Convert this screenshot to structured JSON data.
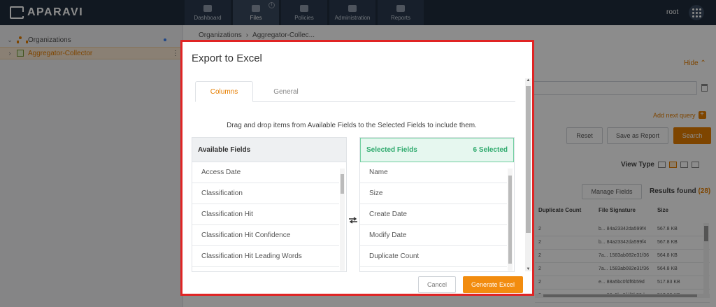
{
  "app": {
    "brand": "APARAVI",
    "user": "root"
  },
  "nav": {
    "tabs": [
      {
        "label": "Dashboard",
        "icon": "dashboard-icon"
      },
      {
        "label": "Files",
        "icon": "folder-icon"
      },
      {
        "label": "Policies",
        "icon": "gear-icon"
      },
      {
        "label": "Administration",
        "icon": "users-icon"
      },
      {
        "label": "Reports",
        "icon": "report-icon"
      }
    ]
  },
  "sidebar": {
    "items": [
      {
        "label": "Organizations"
      },
      {
        "label": "Aggregator-Collector"
      }
    ]
  },
  "breadcrumb": {
    "items": [
      "Organizations",
      "Aggregator-Collec..."
    ]
  },
  "query": {
    "hide_label": "Hide",
    "add_next_query": "Add next query",
    "reset_label": "Reset",
    "save_report_label": "Save as Report",
    "search_label": "Search"
  },
  "results": {
    "view_type_label": "View Type",
    "manage_fields_label": "Manage Fields",
    "results_found_label": "Results found",
    "count": "(28)",
    "columns": [
      "Duplicate Count",
      "File Signature",
      "Size"
    ],
    "rows": [
      [
        "2",
        "b... 84a23342da599f4",
        "567.8 KB"
      ],
      [
        "2",
        "b... 84a23342da599f4",
        "567.8 KB"
      ],
      [
        "2",
        "7a... 1583ab082e31f36",
        "564.8 KB"
      ],
      [
        "2",
        "7a... 1583ab082e31f36",
        "564.8 KB"
      ],
      [
        "2",
        "e... 88a5bc0fdf6b59d",
        "517.83 KB"
      ],
      [
        "2",
        "e... 88a5bc0fdf6b59d",
        "517.83 KB"
      ]
    ]
  },
  "modal": {
    "title": "Export to Excel",
    "tabs": {
      "columns": "Columns",
      "general": "General"
    },
    "instruction": "Drag and drop items from Available Fields to the Selected Fields to include them.",
    "available_title": "Available Fields",
    "available_fields": [
      "Access Date",
      "Classification",
      "Classification Hit",
      "Classification Hit Confidence",
      "Classification Hit Leading Words"
    ],
    "selected_title": "Selected Fields",
    "selected_count": "6 Selected",
    "selected_fields": [
      "Name",
      "Size",
      "Create Date",
      "Modify Date",
      "Duplicate Count"
    ],
    "cancel_label": "Cancel",
    "generate_label": "Generate Excel"
  },
  "colors": {
    "accent": "#e67e00",
    "selected": "#2eaa6d",
    "highlight": "#e02424",
    "nav_bg": "#1f2c3d"
  }
}
